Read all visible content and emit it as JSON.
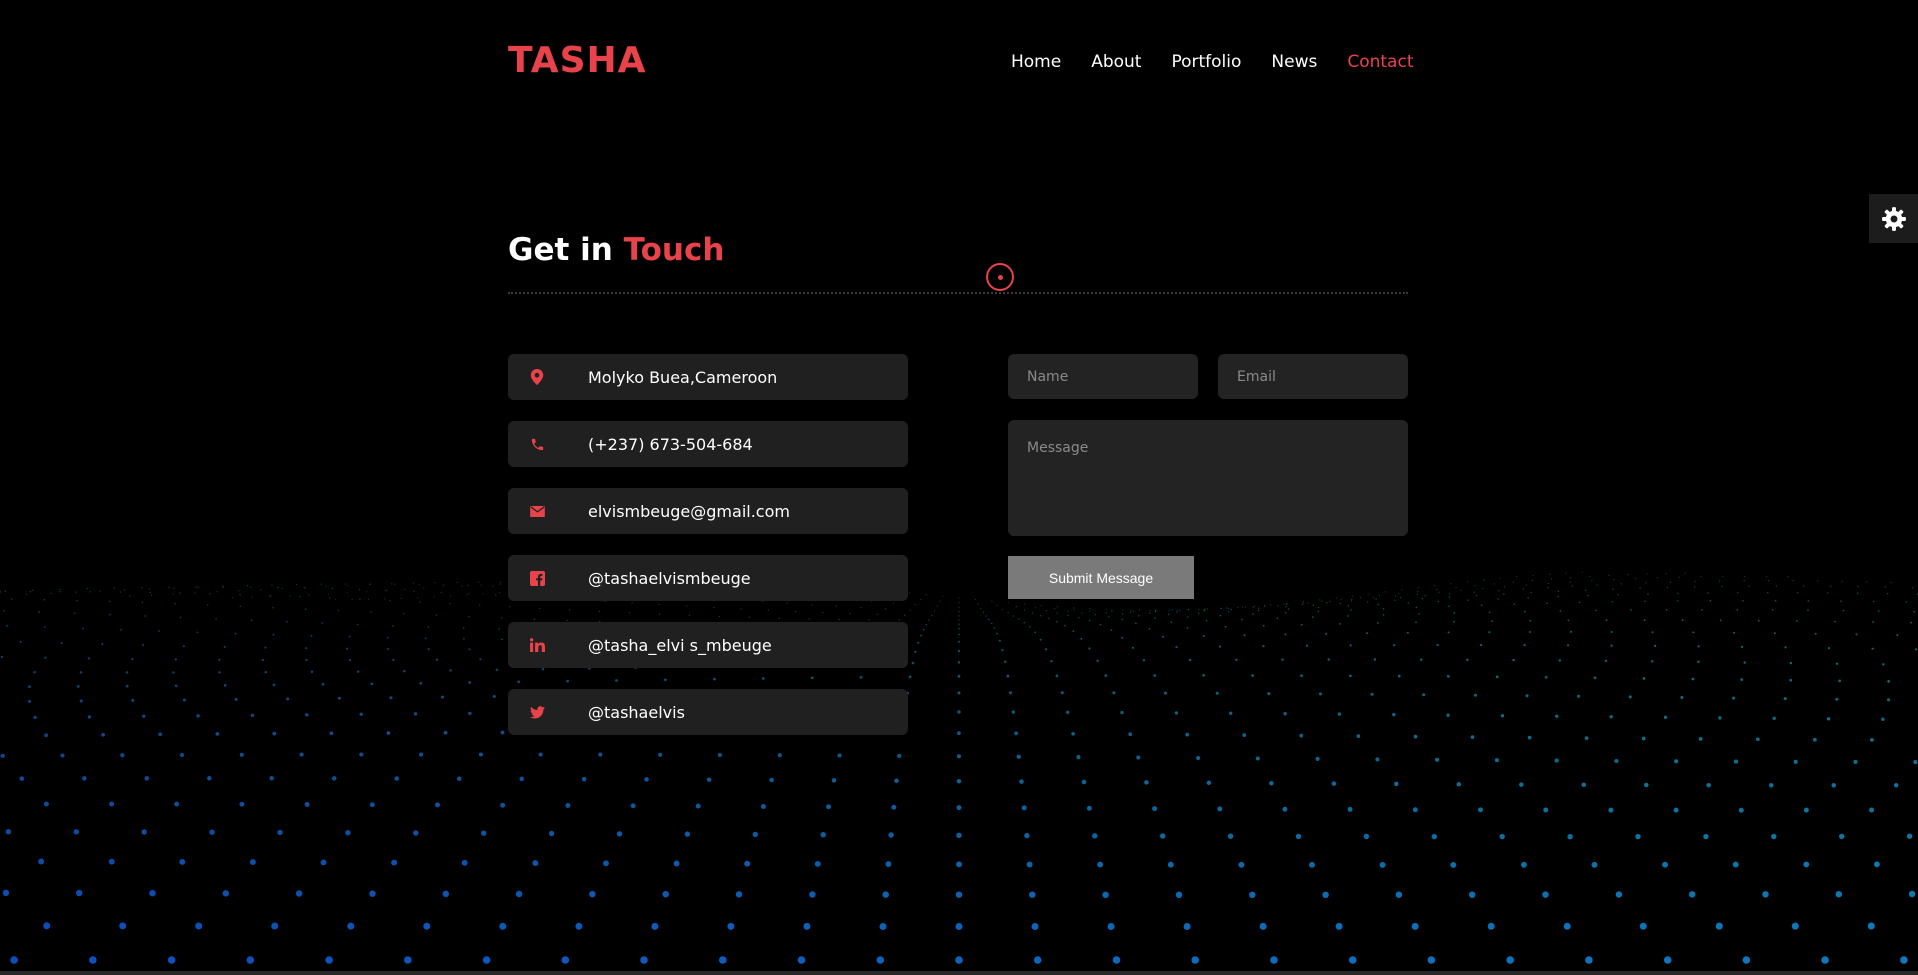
{
  "header": {
    "logo": "TASHA",
    "nav": [
      {
        "label": "Home"
      },
      {
        "label": "About"
      },
      {
        "label": "Portfolio"
      },
      {
        "label": "News"
      },
      {
        "label": "Contact",
        "active": true
      }
    ]
  },
  "settings_icon": "gear-icon",
  "contact": {
    "title_plain": "Get in",
    "title_accent": "Touch",
    "info": [
      {
        "icon": "map-pin-icon",
        "text": "Molyko Buea,Cameroon"
      },
      {
        "icon": "phone-icon",
        "text": "(+237) 673-504-684"
      },
      {
        "icon": "envelope-icon",
        "text": "elvismbeuge@gmail.com"
      },
      {
        "icon": "facebook-icon",
        "text": "@tashaelvismbeuge"
      },
      {
        "icon": "linkedin-icon",
        "text": "@tasha_elvi s_mbeuge"
      },
      {
        "icon": "twitter-icon",
        "text": "@tashaelvis"
      }
    ],
    "form": {
      "name_placeholder": "Name",
      "email_placeholder": "Email",
      "message_placeholder": "Message",
      "submit_label": "Submit Message"
    }
  },
  "colors": {
    "accent": "#e8434b",
    "background": "#000000",
    "card": "#202020",
    "particles": "#1a5f8f"
  }
}
